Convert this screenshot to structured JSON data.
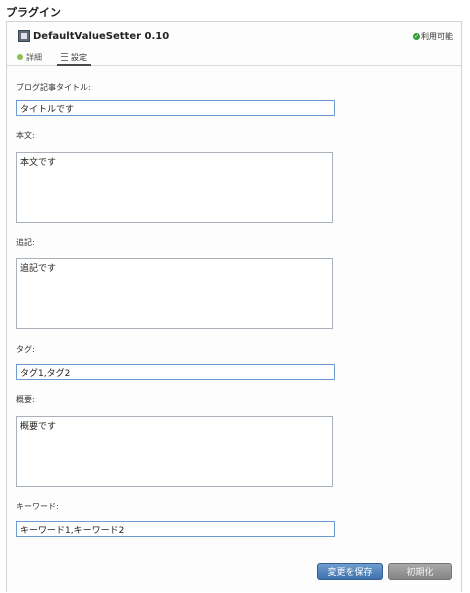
{
  "page": {
    "title": "プラグイン"
  },
  "plugin": {
    "name": "DefaultValueSetter 0.10",
    "status": "利用可能",
    "icons": {
      "plugin": "plugin-icon",
      "status": "check-icon"
    }
  },
  "tabs": [
    {
      "label": "詳細",
      "icon": "dot-icon"
    },
    {
      "label": "設定",
      "icon": "list-icon"
    }
  ],
  "fields": {
    "blog_title": {
      "label": "ブログ記事タイトル:",
      "value": "タイトルです"
    },
    "body": {
      "label": "本文:",
      "value": "本文です"
    },
    "more": {
      "label": "追記:",
      "value": "追記です"
    },
    "tags": {
      "label": "タグ:",
      "value": "タグ1,タグ2"
    },
    "excerpt": {
      "label": "概要:",
      "value": "概要です"
    },
    "keywords": {
      "label": "キーワード:",
      "value": "キーワード1,キーワード2"
    }
  },
  "buttons": {
    "save": "変更を保存",
    "reset": "初期化"
  },
  "colors": {
    "save_button": "#3f72ad",
    "reset_button": "#848484",
    "input_focus_border": "#6b9bd1",
    "status_ok": "#2e9e3a"
  }
}
